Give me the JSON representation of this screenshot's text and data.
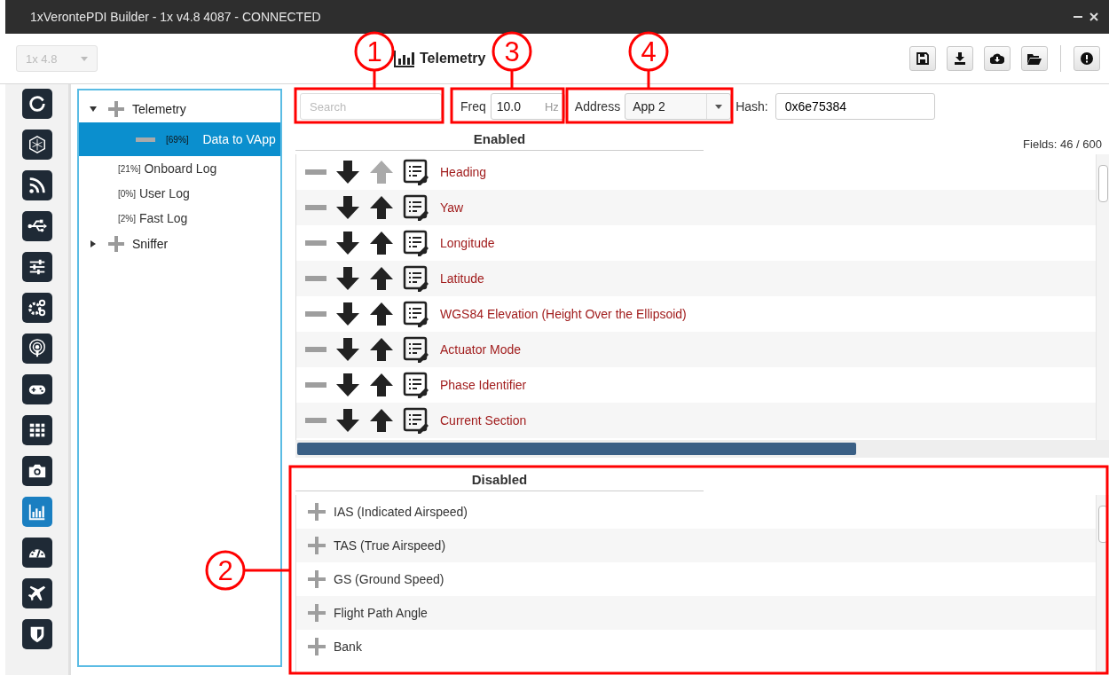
{
  "window": {
    "title": "1xVerontePDI Builder - 1x v4.8 4087 - CONNECTED"
  },
  "toolbar": {
    "version": "1x 4.8",
    "version_disabled": true,
    "title": "Telemetry"
  },
  "sidebar": {
    "items": [
      {
        "selected": false
      },
      {
        "selected": false
      },
      {
        "selected": false
      },
      {
        "selected": false
      },
      {
        "selected": false
      },
      {
        "selected": false
      },
      {
        "selected": false
      },
      {
        "selected": false
      },
      {
        "selected": false
      },
      {
        "selected": false
      },
      {
        "selected": true
      },
      {
        "selected": false
      },
      {
        "selected": false
      },
      {
        "selected": false
      }
    ]
  },
  "tree": [
    {
      "label": "Telemetry",
      "expanded": true,
      "children": [
        {
          "percent": "[69%]",
          "label": "Data to VApp",
          "active": true,
          "selected": true
        },
        {
          "percent": "[21%]",
          "label": "Onboard Log",
          "active": false,
          "selected": false
        },
        {
          "percent": "[0%]",
          "label": "User Log",
          "active": false,
          "selected": false
        },
        {
          "percent": "[2%]",
          "label": "Fast Log",
          "active": false,
          "selected": false
        }
      ]
    },
    {
      "label": "Sniffer",
      "expanded": false
    }
  ],
  "filters": {
    "search_placeholder": "Search",
    "freq_label": "Freq",
    "freq": "10.0",
    "freq_unit": "Hz",
    "address_label": "Address",
    "address": "App 2",
    "hash_label": "Hash:",
    "hash": "0x6e75384"
  },
  "enabled": {
    "title": "Enabled",
    "fields": "Fields: 46 / 600",
    "rows": [
      {
        "name": "Heading",
        "up_enabled": false
      },
      {
        "name": "Yaw",
        "up_enabled": true
      },
      {
        "name": "Longitude",
        "up_enabled": true
      },
      {
        "name": "Latitude",
        "up_enabled": true
      },
      {
        "name": "WGS84 Elevation (Height Over the Ellipsoid)",
        "up_enabled": true
      },
      {
        "name": "Actuator Mode",
        "up_enabled": true
      },
      {
        "name": "Phase Identifier",
        "up_enabled": true
      },
      {
        "name": "Current Section",
        "up_enabled": true
      }
    ]
  },
  "disabled": {
    "title": "Disabled",
    "rows": [
      {
        "name": "IAS (Indicated Airspeed)"
      },
      {
        "name": "TAS (True Airspeed)"
      },
      {
        "name": "GS (Ground Speed)"
      },
      {
        "name": "Flight Path Angle"
      },
      {
        "name": "Bank"
      }
    ]
  },
  "callouts": [
    {
      "number": "1"
    },
    {
      "number": "2"
    },
    {
      "number": "3"
    },
    {
      "number": "4"
    }
  ]
}
